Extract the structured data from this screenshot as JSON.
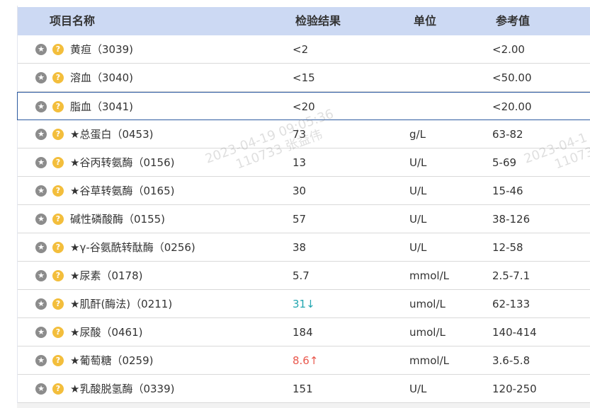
{
  "headers": {
    "name": "项目名称",
    "result": "检验结果",
    "unit": "单位",
    "reference": "参考值"
  },
  "rows": [
    {
      "name": "黄疸（3039)",
      "result": "<2",
      "unit": "",
      "reference": "<2.00",
      "flag": ""
    },
    {
      "name": "溶血（3040)",
      "result": "<15",
      "unit": "",
      "reference": "<50.00",
      "flag": ""
    },
    {
      "name": "脂血（3041)",
      "result": "<20",
      "unit": "",
      "reference": "<20.00",
      "flag": ""
    },
    {
      "name": "★总蛋白（0453)",
      "result": "73",
      "unit": "g/L",
      "reference": "63-82",
      "flag": ""
    },
    {
      "name": "★谷丙转氨酶（0156)",
      "result": "13",
      "unit": "U/L",
      "reference": "5-69",
      "flag": ""
    },
    {
      "name": "★谷草转氨酶（0165)",
      "result": "30",
      "unit": "U/L",
      "reference": "15-46",
      "flag": ""
    },
    {
      "name": "碱性磷酸酶（0155)",
      "result": "57",
      "unit": "U/L",
      "reference": "38-126",
      "flag": ""
    },
    {
      "name": "★γ-谷氨酰转酞酶（0256)",
      "result": "38",
      "unit": "U/L",
      "reference": "12-58",
      "flag": ""
    },
    {
      "name": "★尿素（0178)",
      "result": "5.7",
      "unit": "mmol/L",
      "reference": "2.5-7.1",
      "flag": ""
    },
    {
      "name": "★肌酐(酶法)（0211)",
      "result": "31↓",
      "unit": "umol/L",
      "reference": "62-133",
      "flag": "low"
    },
    {
      "name": "★尿酸（0461)",
      "result": "184",
      "unit": "umol/L",
      "reference": "140-414",
      "flag": ""
    },
    {
      "name": "★葡萄糖（0259)",
      "result": "8.6↑",
      "unit": "mmol/L",
      "reference": "3.6-5.8",
      "flag": "high"
    },
    {
      "name": "★乳酸脱氢酶（0339)",
      "result": "151",
      "unit": "U/L",
      "reference": "120-250",
      "flag": ""
    }
  ],
  "watermark": {
    "line1": "2023-04-19 09:05:36",
    "line2": "110733 张益伟",
    "line1_partial": "2023-04-1",
    "line2_partial": "11073"
  },
  "icons": {
    "favorite": "star-icon",
    "help": "question-icon"
  },
  "colors": {
    "header_bg": "#ccd9f3",
    "low_flag": "#23a6b0",
    "high_flag": "#e9584d",
    "help_icon": "#f3be3c"
  }
}
